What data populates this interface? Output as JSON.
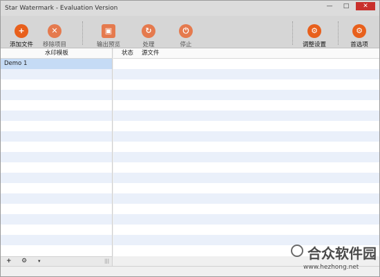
{
  "window": {
    "title": "Star Watermark - Evaluation Version",
    "controls": {
      "minimize": "—",
      "maximize": "□",
      "close": "✕"
    }
  },
  "toolbar": {
    "add_files": {
      "label": "添加文件",
      "icon": "add-file-icon",
      "color": "#e8601c"
    },
    "remove_item": {
      "label": "移除项目",
      "icon": "remove-icon",
      "color": "#e8601c"
    },
    "output_preview": {
      "label": "输出预览",
      "icon": "preview-icon",
      "color": "#e8601c"
    },
    "process": {
      "label": "处理",
      "icon": "process-icon",
      "color": "#e8601c"
    },
    "stop": {
      "label": "停止",
      "icon": "stop-icon",
      "color": "#e8601c"
    },
    "adjust_settings": {
      "label": "调整设置",
      "icon": "settings-gear-icon",
      "color": "#e8601c"
    },
    "preferences": {
      "label": "首选项",
      "icon": "preferences-gear-icon",
      "color": "#e8601c"
    }
  },
  "left_panel": {
    "header": "水印模板",
    "items": [
      "Demo 1"
    ],
    "footer": {
      "add": "+",
      "settings": "⚙",
      "dropdown": "▾",
      "grip": "|||"
    }
  },
  "right_panel": {
    "columns": {
      "status": "状态",
      "source_file": "源文件"
    }
  },
  "watermark": {
    "site_name": "合众软件园",
    "site_url": "www.hezhong.net"
  }
}
